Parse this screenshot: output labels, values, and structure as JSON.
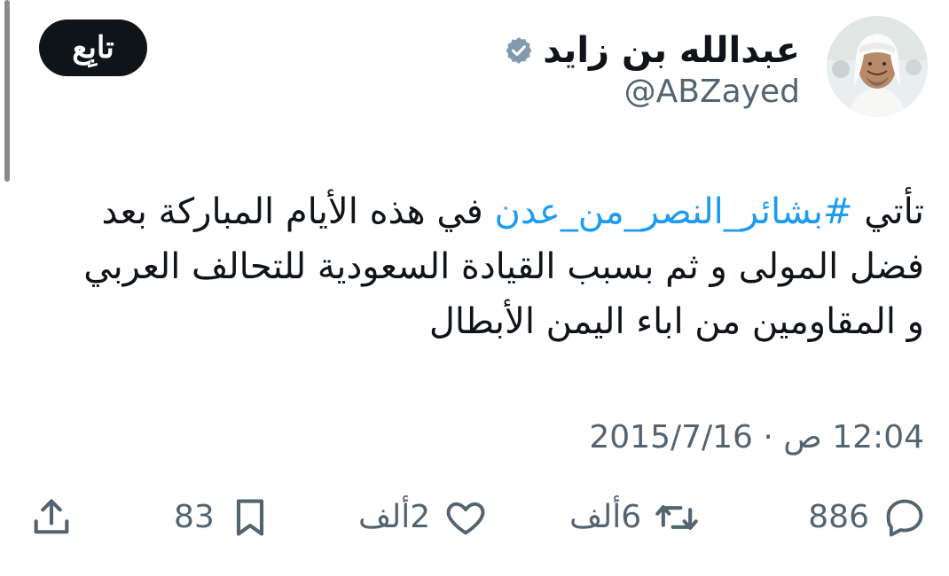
{
  "author": {
    "display_name": "عبدالله بن زايد",
    "handle": "@ABZayed",
    "verified": true,
    "avatar_icon": "profile-photo"
  },
  "follow_button": {
    "label": "تابِع"
  },
  "tweet": {
    "line1_prefix": "تأتي ",
    "hashtag": "#بشائر_النصر_من_عدن",
    "line1_suffix": " في هذه الأيام المباركة بعد",
    "line2": "فضل المولى و ثم بسبب القيادة السعودية للتحالف العربي",
    "line3": "و المقاومين من اباء اليمن الأبطال"
  },
  "timestamp": "12:04 ص · 2015/7/16",
  "actions": {
    "reply_count": "886",
    "retweet_count": "6ألف",
    "like_count": "2ألف",
    "bookmark_count": "83"
  },
  "colors": {
    "text": "#0f1419",
    "secondary": "#536471",
    "link": "#1d9bf0",
    "button": "#0f1419"
  }
}
